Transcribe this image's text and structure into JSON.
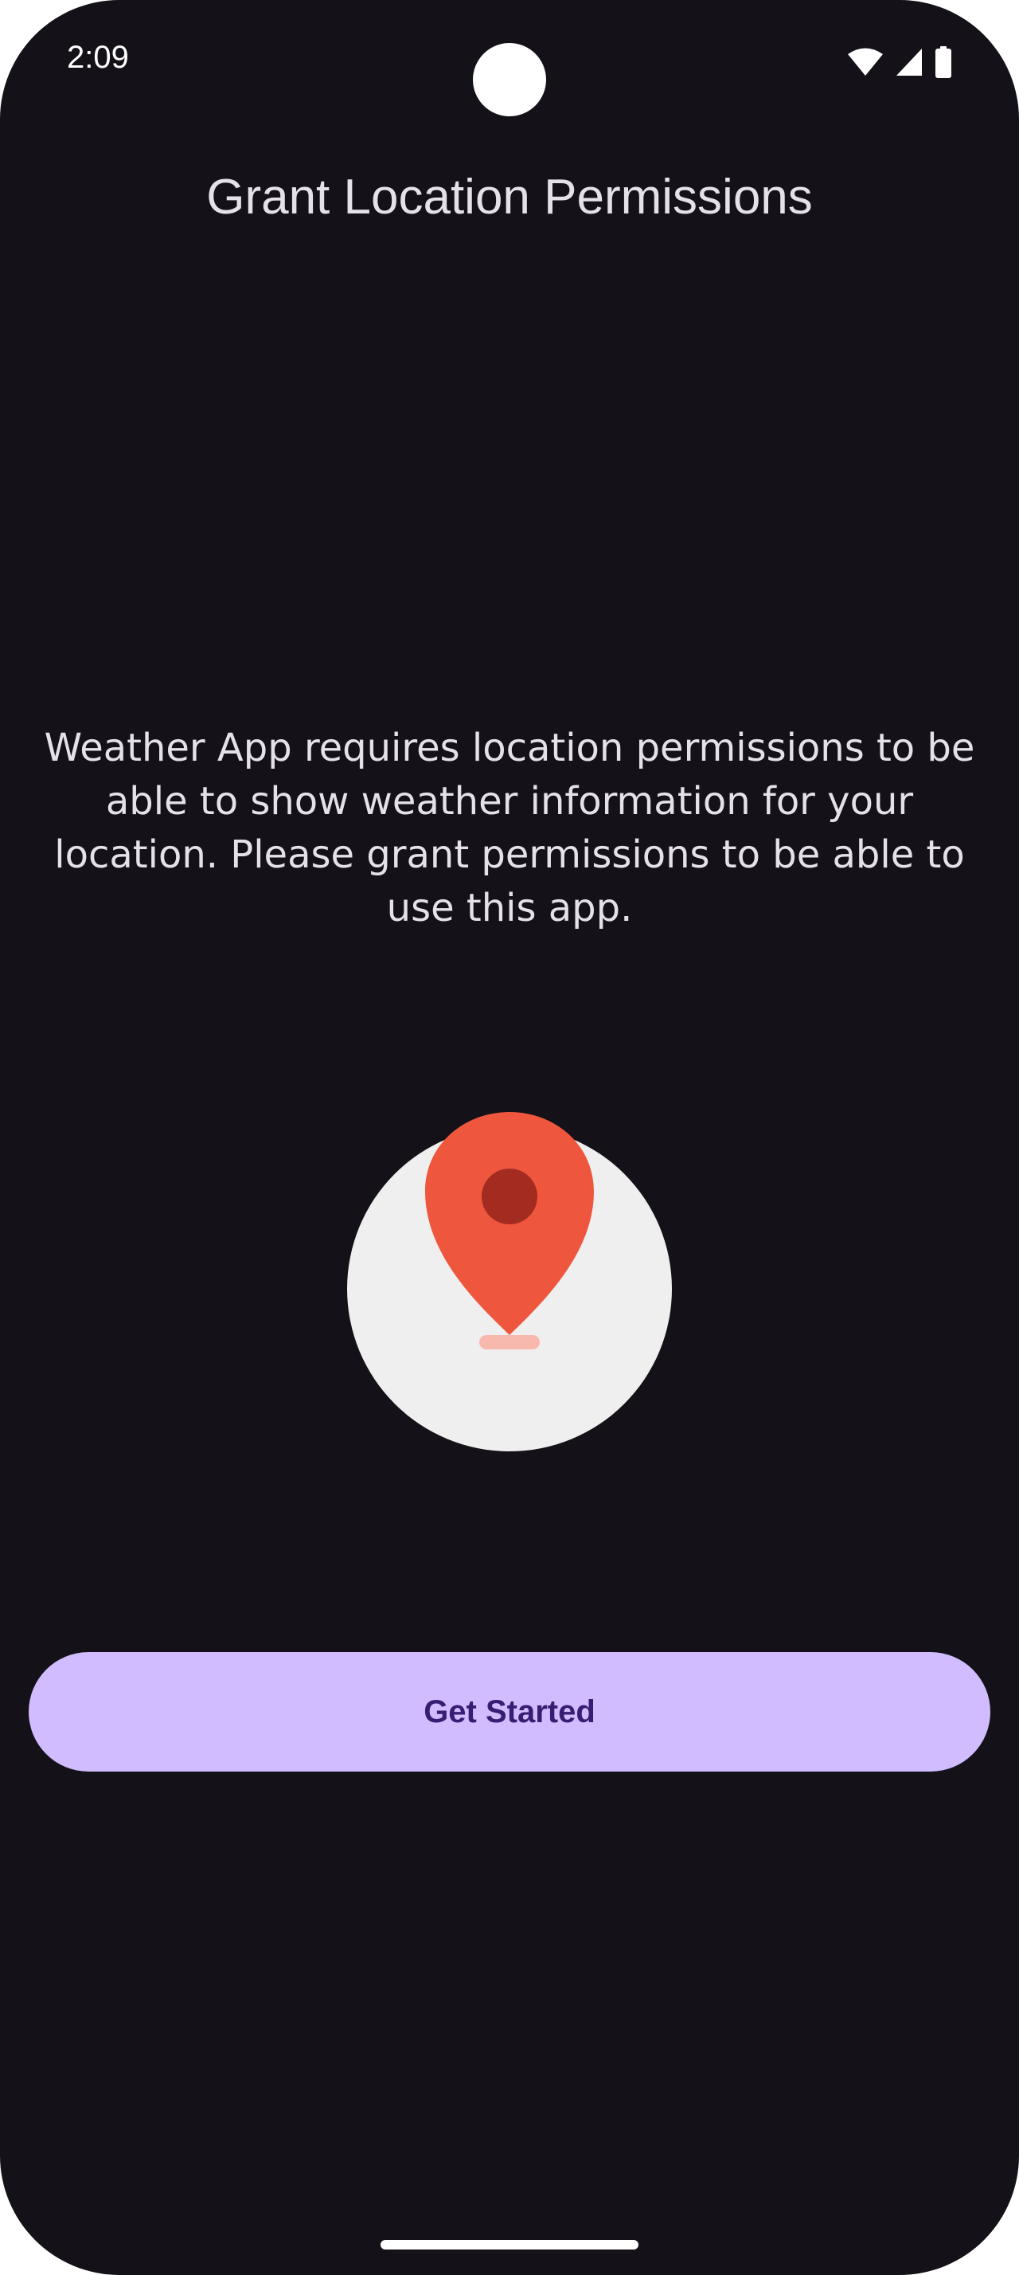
{
  "status_bar": {
    "time": "2:09",
    "icons": [
      "wifi-icon",
      "cellular-signal-icon",
      "battery-icon"
    ]
  },
  "screen": {
    "title": "Grant Location Permissions",
    "message": "Weather App requires location permissions to be able to show weather information for your location. Please grant permissions to be able to use this app.",
    "illustration_icon": "location-pin-icon",
    "cta_label": "Get Started"
  },
  "colors": {
    "background": "#141218",
    "text": "#e6e0e9",
    "button_background": "#d0bcff",
    "button_text": "#381e72",
    "pin": "#ee573d",
    "pin_dot": "#a32b20",
    "pin_shadow": "#f7b8ad",
    "circle": "#f0efef"
  }
}
